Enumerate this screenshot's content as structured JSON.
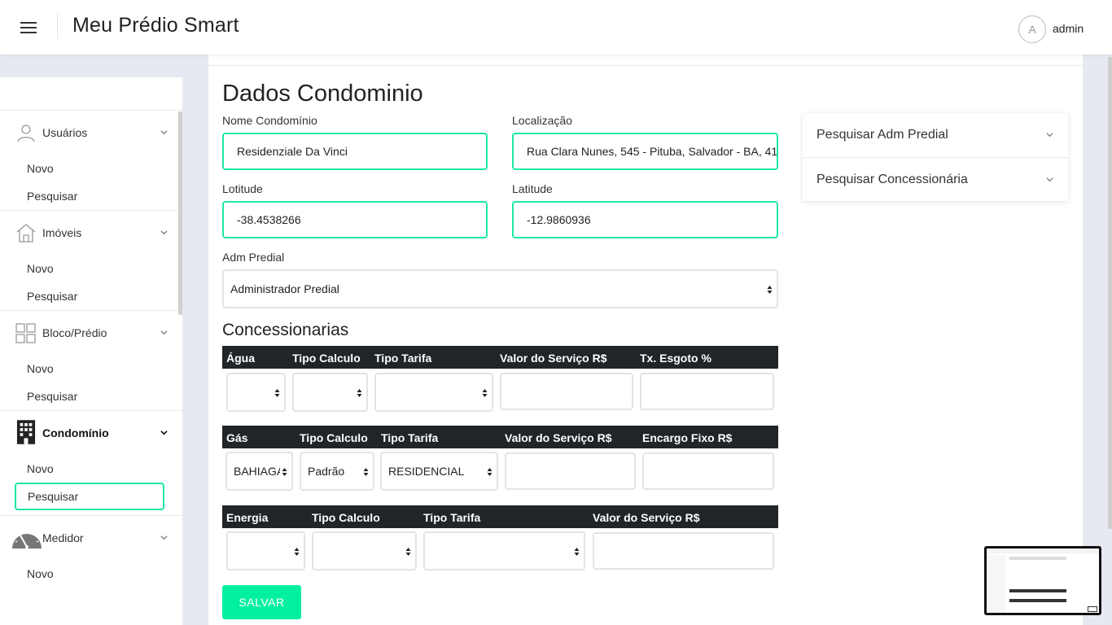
{
  "header": {
    "brand": "Meu Prédio Smart",
    "avatar_letter": "A",
    "username": "admin"
  },
  "sidebar": {
    "groups": [
      {
        "label": "Usuários",
        "icon": "user-icon",
        "items": [
          "Novo",
          "Pesquisar"
        ]
      },
      {
        "label": "Imóveis",
        "icon": "home-icon",
        "items": [
          "Novo",
          "Pesquisar"
        ]
      },
      {
        "label": "Bloco/Prédio",
        "icon": "grid-icon",
        "items": [
          "Novo",
          "Pesquisar"
        ]
      },
      {
        "label": "Condomínio",
        "icon": "building-icon",
        "items": [
          "Novo",
          "Pesquisar"
        ],
        "active": true,
        "selected_item": "Pesquisar"
      },
      {
        "label": "Medidor",
        "icon": "gauge-icon",
        "items": [
          "Novo"
        ]
      }
    ]
  },
  "form": {
    "title": "Dados Condominio",
    "nome_label": "Nome Condomínio",
    "nome_value": "Residenziale Da Vinci",
    "localizacao_label": "Localização",
    "localizacao_value": "Rua Clara Nunes, 545 - Pituba, Salvador - BA, 41",
    "lotitude_label": "Lotitude",
    "lotitude_value": "-38.4538266",
    "latitude_label": "Latitude",
    "latitude_value": "-12.9860936",
    "adm_label": "Adm Predial",
    "adm_value": "Administrador Predial"
  },
  "concessionarias": {
    "title": "Concessionarias",
    "agua": {
      "headers": [
        "Água",
        "Tipo Calculo",
        "Tipo Tarifa",
        "Valor do Serviço R$",
        "Tx. Esgoto %"
      ]
    },
    "gas": {
      "headers": [
        "Gás",
        "Tipo Calculo",
        "Tipo Tarifa",
        "Valor do Serviço R$",
        "Encargo Fixo R$"
      ],
      "values": [
        "BAHIAGÁS",
        "Padrão",
        "RESIDENCIAL"
      ]
    },
    "energia": {
      "headers": [
        "Energia",
        "Tipo Calculo",
        "Tipo Tarifa",
        "Valor do Serviço R$"
      ]
    }
  },
  "save_label": "SALVAR",
  "accordion": [
    "Pesquisar Adm Predial",
    "Pesquisar Concessionária"
  ],
  "colors": {
    "accent": "#1de9a0",
    "button": "#00f0a0",
    "table_header": "#212529",
    "background": "#e6e9f2"
  }
}
